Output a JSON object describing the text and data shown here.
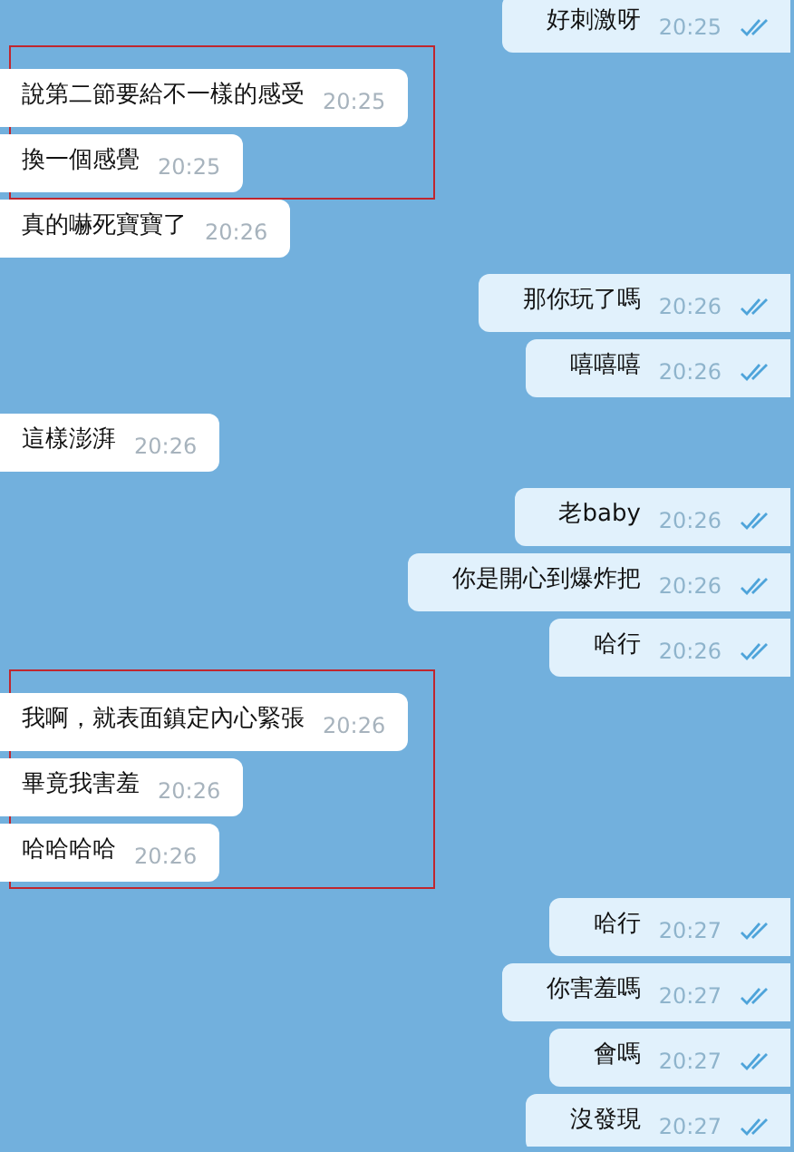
{
  "sections": [
    {
      "highlighted": false,
      "messages": [
        {
          "kind": "sent",
          "text": "好刺激呀",
          "time": "20:25",
          "read": true
        }
      ]
    },
    {
      "highlighted": true,
      "messages": [
        {
          "kind": "received",
          "text": "說第二節要給不一樣的感受",
          "time": "20:25"
        },
        {
          "kind": "received",
          "text": "換一個感覺",
          "time": "20:25"
        }
      ]
    },
    {
      "highlighted": false,
      "messages": [
        {
          "kind": "received",
          "text": "真的嚇死寶寶了",
          "time": "20:26"
        },
        {
          "kind": "sent",
          "text": "那你玩了嗎",
          "time": "20:26",
          "read": true
        },
        {
          "kind": "sent",
          "text": "嘻嘻嘻",
          "time": "20:26",
          "read": true
        },
        {
          "kind": "received",
          "text": "這樣澎湃",
          "time": "20:26"
        },
        {
          "kind": "sent",
          "text": "老baby",
          "time": "20:26",
          "read": true
        },
        {
          "kind": "sent",
          "text": "你是開心到爆炸把",
          "time": "20:26",
          "read": true
        },
        {
          "kind": "sent",
          "text": "哈行",
          "time": "20:26",
          "read": true
        }
      ]
    },
    {
      "highlighted": true,
      "messages": [
        {
          "kind": "received",
          "text": "我啊，就表面鎮定內心緊張",
          "time": "20:26"
        },
        {
          "kind": "received",
          "text": "畢竟我害羞",
          "time": "20:26"
        },
        {
          "kind": "received",
          "text": "哈哈哈哈",
          "time": "20:26"
        }
      ]
    },
    {
      "highlighted": false,
      "messages": [
        {
          "kind": "sent",
          "text": "哈行",
          "time": "20:27",
          "read": true
        },
        {
          "kind": "sent",
          "text": "你害羞嗎",
          "time": "20:27",
          "read": true
        },
        {
          "kind": "sent",
          "text": "會嗎",
          "time": "20:27",
          "read": true
        },
        {
          "kind": "sent",
          "text": "沒發現",
          "time": "20:27",
          "read": true
        }
      ]
    }
  ]
}
